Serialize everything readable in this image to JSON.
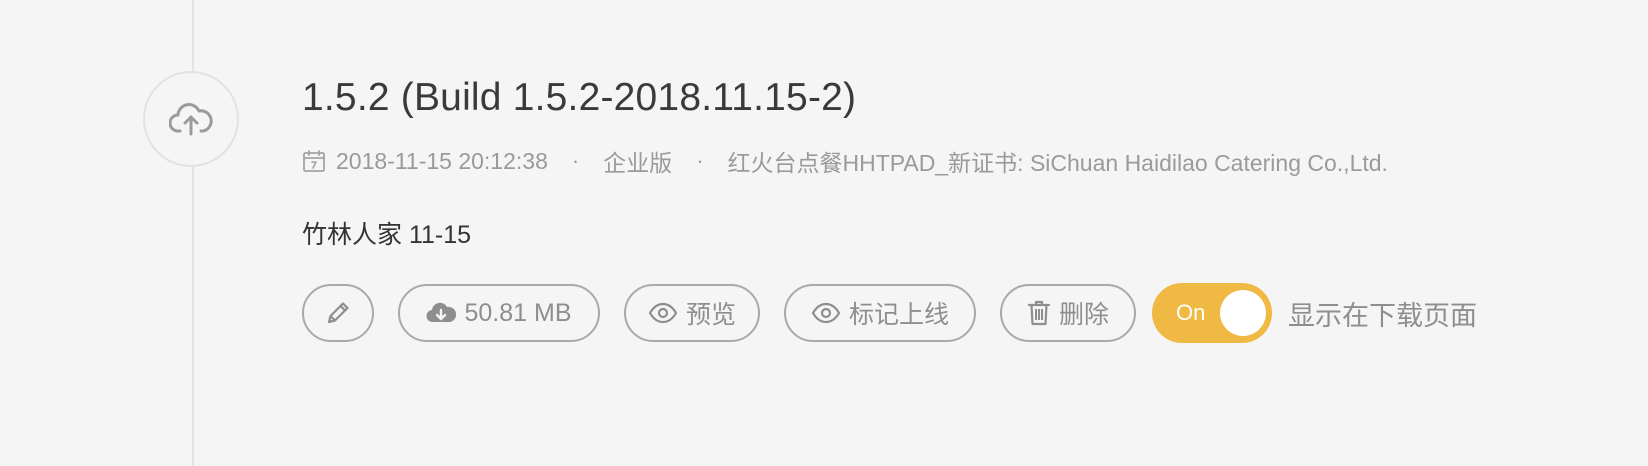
{
  "release": {
    "title": "1.5.2 (Build 1.5.2-2018.11.15-2)",
    "date": "2018-11-15 20:12:38",
    "edition": "企业版",
    "certificate": "红火台点餐HHTPAD_新证书: SiChuan Haidilao Catering Co.,Ltd.",
    "separator": "·",
    "note": "竹林人家 11-15"
  },
  "actions": {
    "size_label": "50.81 MB",
    "preview_label": "预览",
    "mark_online_label": "标记上线",
    "delete_label": "删除"
  },
  "toggle": {
    "state_label": "On",
    "caption": "显示在下载页面",
    "on": true
  },
  "icons": {
    "node": "cloud-upload-icon",
    "date": "calendar-icon",
    "edit": "pencil-icon",
    "download": "cloud-download-icon",
    "preview": "eye-icon",
    "mark": "eye-icon",
    "delete": "trash-icon"
  },
  "colors": {
    "accent": "#f0b944",
    "muted_text": "#9a9a9a",
    "border": "#a9a9a9",
    "background": "#f5f5f5"
  }
}
